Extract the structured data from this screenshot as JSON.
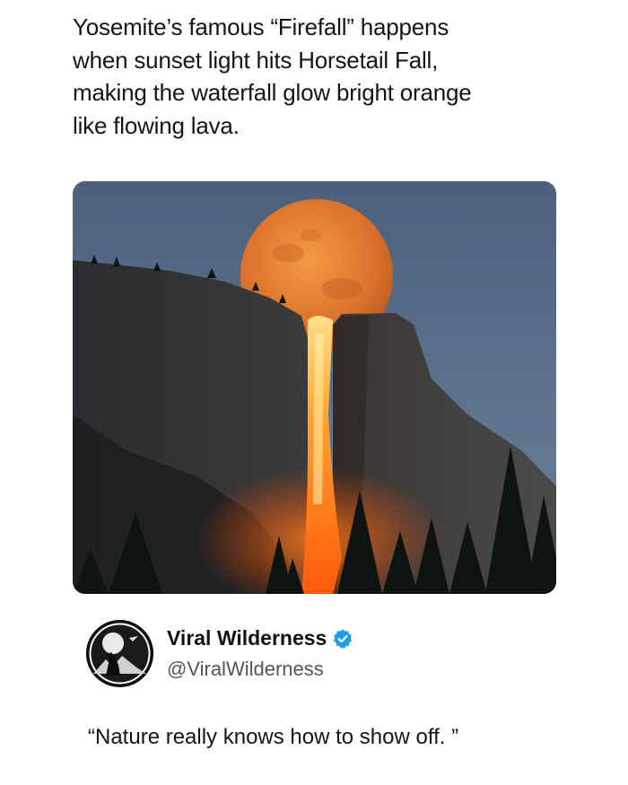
{
  "post": {
    "lines": [
      "Yosemite’s famous “Firefall” happens",
      "when sunset light hits Horsetail Fall,",
      "making the waterfall glow bright orange",
      "like flowing lava."
    ]
  },
  "photo": {
    "sky_color": "#5b6f88",
    "moon_color": "#e07a2a",
    "lava_color": "#ff8c1a"
  },
  "author": {
    "name": "Viral Wilderness",
    "handle": "@ViralWilderness",
    "verified": true,
    "badge_color": "#1d9bf0"
  },
  "quote": {
    "open_mark": "“",
    "text": "Nature really knows how to show off. ",
    "close_mark": "”"
  }
}
